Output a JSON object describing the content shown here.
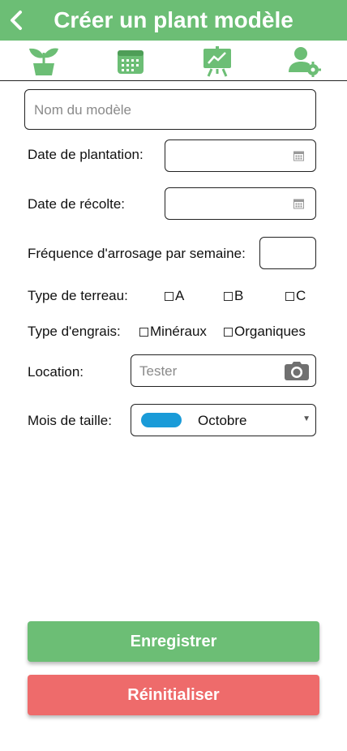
{
  "header": {
    "title": "Créer un plant modèle"
  },
  "tabs": [
    "plant-tab",
    "calendar-tab",
    "stats-tab",
    "user-settings-tab"
  ],
  "form": {
    "name_placeholder": "Nom du modèle",
    "planting_date_label": "Date de plantation:",
    "harvest_date_label": "Date de récolte:",
    "watering_label": "Fréquence d'arrosage par semaine:",
    "soil_label": "Type de terreau:",
    "soil_options": [
      "A",
      "B",
      "C"
    ],
    "fertilizer_label": "Type d'engrais:",
    "fertilizer_options": [
      "Minéraux",
      "Organiques"
    ],
    "location_label": "Location:",
    "location_placeholder": "Tester",
    "pruning_label": "Mois de taille:",
    "pruning_value": "Octobre"
  },
  "buttons": {
    "save": "Enregistrer",
    "reset": "Réinitialiser"
  },
  "colors": {
    "primary": "#6cbe75",
    "danger": "#ee6b6b",
    "pill": "#1a9bd8"
  }
}
